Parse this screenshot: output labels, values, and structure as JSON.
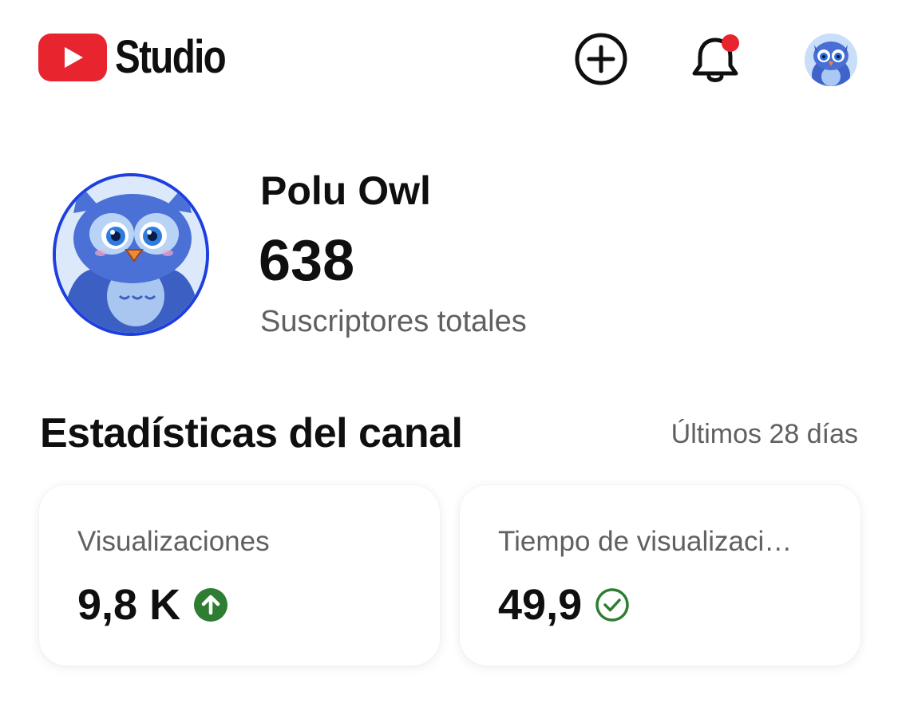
{
  "header": {
    "brand": "Studio",
    "create_icon": "add-circle-icon",
    "notifications_icon": "bell-icon",
    "notification_dot_color": "#e8242f",
    "brand_color": "#e8242f"
  },
  "channel": {
    "name": "Polu Owl",
    "subscribers": "638",
    "subscribers_label": "Suscriptores totales"
  },
  "stats": {
    "title": "Estadísticas del canal",
    "period": "Últimos 28 días",
    "cards": [
      {
        "label": "Visualizaciones",
        "value": "9,8 K",
        "indicator": "arrow-up-circle-icon",
        "indicator_color": "#2e7d32"
      },
      {
        "label": "Tiempo de visualizaci…",
        "value": "49,9",
        "indicator": "check-circle-icon",
        "indicator_color": "#2e7d32"
      }
    ]
  }
}
